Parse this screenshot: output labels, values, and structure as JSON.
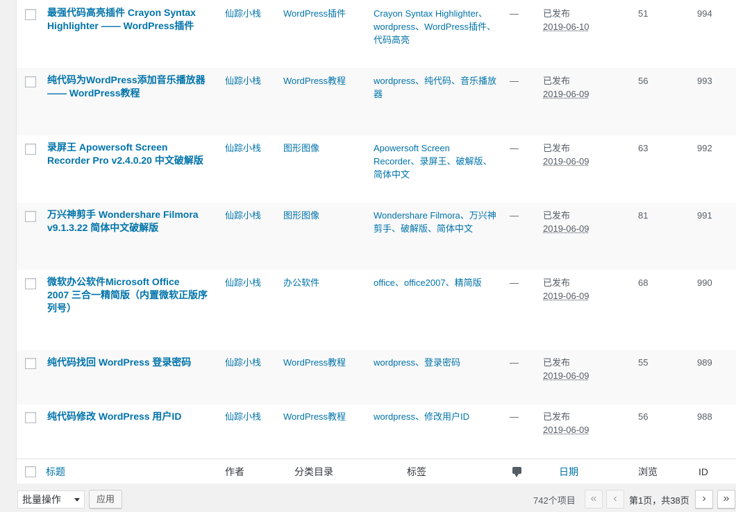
{
  "posts": [
    {
      "title": [
        "最强代码高亮插件 Crayon Syntax",
        "Highlighter —— WordPress插件"
      ],
      "author": "仙踪小栈",
      "category": "WordPress插件",
      "tags": [
        "Crayon Syntax Highlighter、",
        "wordpress、WordPress插件、",
        "代码高亮"
      ],
      "comments": "—",
      "status": "已发布",
      "date": "2019-06-10",
      "views": "51",
      "id": "994"
    },
    {
      "title": [
        "纯代码为WordPress添加音乐播放器",
        "—— WordPress教程"
      ],
      "author": "仙踪小栈",
      "category": "WordPress教程",
      "tags": [
        "wordpress、纯代码、音乐播放",
        "器"
      ],
      "comments": "—",
      "status": "已发布",
      "date": "2019-06-09",
      "views": "56",
      "id": "993"
    },
    {
      "title": [
        "录屏王 Apowersoft Screen",
        "Recorder Pro v2.4.0.20 中文破解版"
      ],
      "author": "仙踪小栈",
      "category": "图形图像",
      "tags": [
        "Apowersoft Screen",
        "Recorder、录屏王、破解版、",
        "简体中文"
      ],
      "comments": "—",
      "status": "已发布",
      "date": "2019-06-09",
      "views": "63",
      "id": "992"
    },
    {
      "title": [
        "万兴神剪手 Wondershare Filmora",
        "v9.1.3.22 简体中文破解版"
      ],
      "author": "仙踪小栈",
      "category": "图形图像",
      "tags": [
        "Wondershare Filmora、万兴神",
        "剪手、破解版、简体中文"
      ],
      "comments": "—",
      "status": "已发布",
      "date": "2019-06-09",
      "views": "81",
      "id": "991"
    },
    {
      "title": [
        "微软办公软件Microsoft Office",
        "2007 三合一精简版（内置微软正版序",
        "列号）"
      ],
      "author": "仙踪小栈",
      "category": "办公软件",
      "tags": [
        "office、office2007、精简版"
      ],
      "comments": "—",
      "status": "已发布",
      "date": "2019-06-09",
      "views": "68",
      "id": "990"
    },
    {
      "title": [
        "纯代码找回 WordPress 登录密码"
      ],
      "author": "仙踪小栈",
      "category": "WordPress教程",
      "tags": [
        "wordpress、登录密码"
      ],
      "comments": "—",
      "status": "已发布",
      "date": "2019-06-09",
      "views": "55",
      "id": "989"
    },
    {
      "title": [
        "纯代码修改 WordPress 用户ID"
      ],
      "author": "仙踪小栈",
      "category": "WordPress教程",
      "tags": [
        "wordpress、修改用户ID"
      ],
      "comments": "—",
      "status": "已发布",
      "date": "2019-06-09",
      "views": "56",
      "id": "988"
    }
  ],
  "columns": {
    "title": "标题",
    "author": "作者",
    "category": "分类目录",
    "tags": "标签",
    "comments_icon": "comment-icon",
    "date": "日期",
    "views": "浏览",
    "id": "ID"
  },
  "bulk_actions": {
    "selected": "批量操作",
    "apply_label": "应用"
  },
  "pagination": {
    "items_count": "742个项目",
    "first": "«",
    "prev": "‹",
    "page_info": "第1页，共38页",
    "next": "›",
    "last": "»"
  }
}
